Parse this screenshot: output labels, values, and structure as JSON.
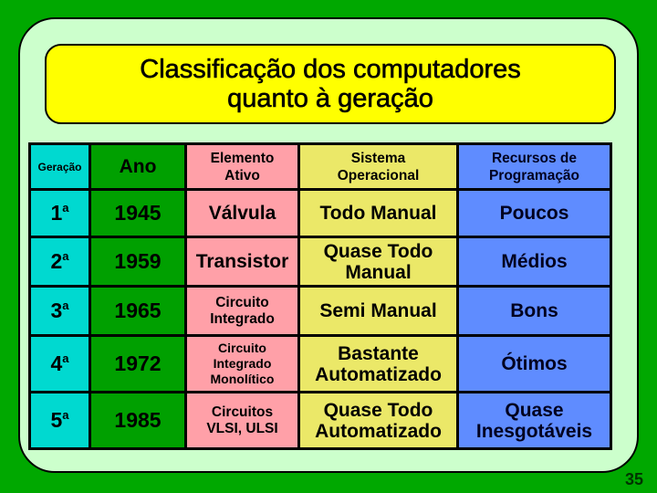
{
  "slide": {
    "title_line1": "Classificação dos computadores",
    "title_line2": "quanto à geração",
    "page_number": "35",
    "colors": {
      "background": "#00a800",
      "panel": "#ccffcc",
      "title_box": "#ffff00",
      "col_geracao": "#00d9d0",
      "col_ano": "#00a000",
      "col_elemento": "#ffa0a8",
      "col_sistema": "#ebe868",
      "col_recursos": "#5f8cff"
    }
  },
  "table": {
    "headers": {
      "geracao": "Geração",
      "ano": "Ano",
      "elemento_l1": "Elemento",
      "elemento_l2": "Ativo",
      "sistema_l1": "Sistema",
      "sistema_l2": "Operacional",
      "recursos_l1": "Recursos de",
      "recursos_l2": "Programação"
    },
    "rows": [
      {
        "geracao_num": "1",
        "geracao_sup": "a",
        "ano": "1945",
        "elemento": [
          "Válvula"
        ],
        "sistema": [
          "Todo Manual"
        ],
        "recursos": [
          "Poucos"
        ]
      },
      {
        "geracao_num": "2",
        "geracao_sup": "a",
        "ano": "1959",
        "elemento": [
          "Transistor"
        ],
        "sistema": [
          "Quase Todo",
          "Manual"
        ],
        "recursos": [
          "Médios"
        ]
      },
      {
        "geracao_num": "3",
        "geracao_sup": "a",
        "ano": "1965",
        "elemento": [
          "Circuito",
          "Integrado"
        ],
        "sistema": [
          "Semi Manual"
        ],
        "recursos": [
          "Bons"
        ]
      },
      {
        "geracao_num": "4",
        "geracao_sup": "a",
        "ano": "1972",
        "elemento": [
          "Circuito",
          "Integrado",
          "Monolítico"
        ],
        "sistema": [
          "Bastante",
          "Automatizado"
        ],
        "recursos": [
          "Ótimos"
        ]
      },
      {
        "geracao_num": "5",
        "geracao_sup": "a",
        "ano": "1985",
        "elemento": [
          "Circuitos",
          "VLSI, ULSI"
        ],
        "sistema": [
          "Quase Todo",
          "Automatizado"
        ],
        "recursos": [
          "Quase",
          "Inesgotáveis"
        ]
      }
    ]
  }
}
